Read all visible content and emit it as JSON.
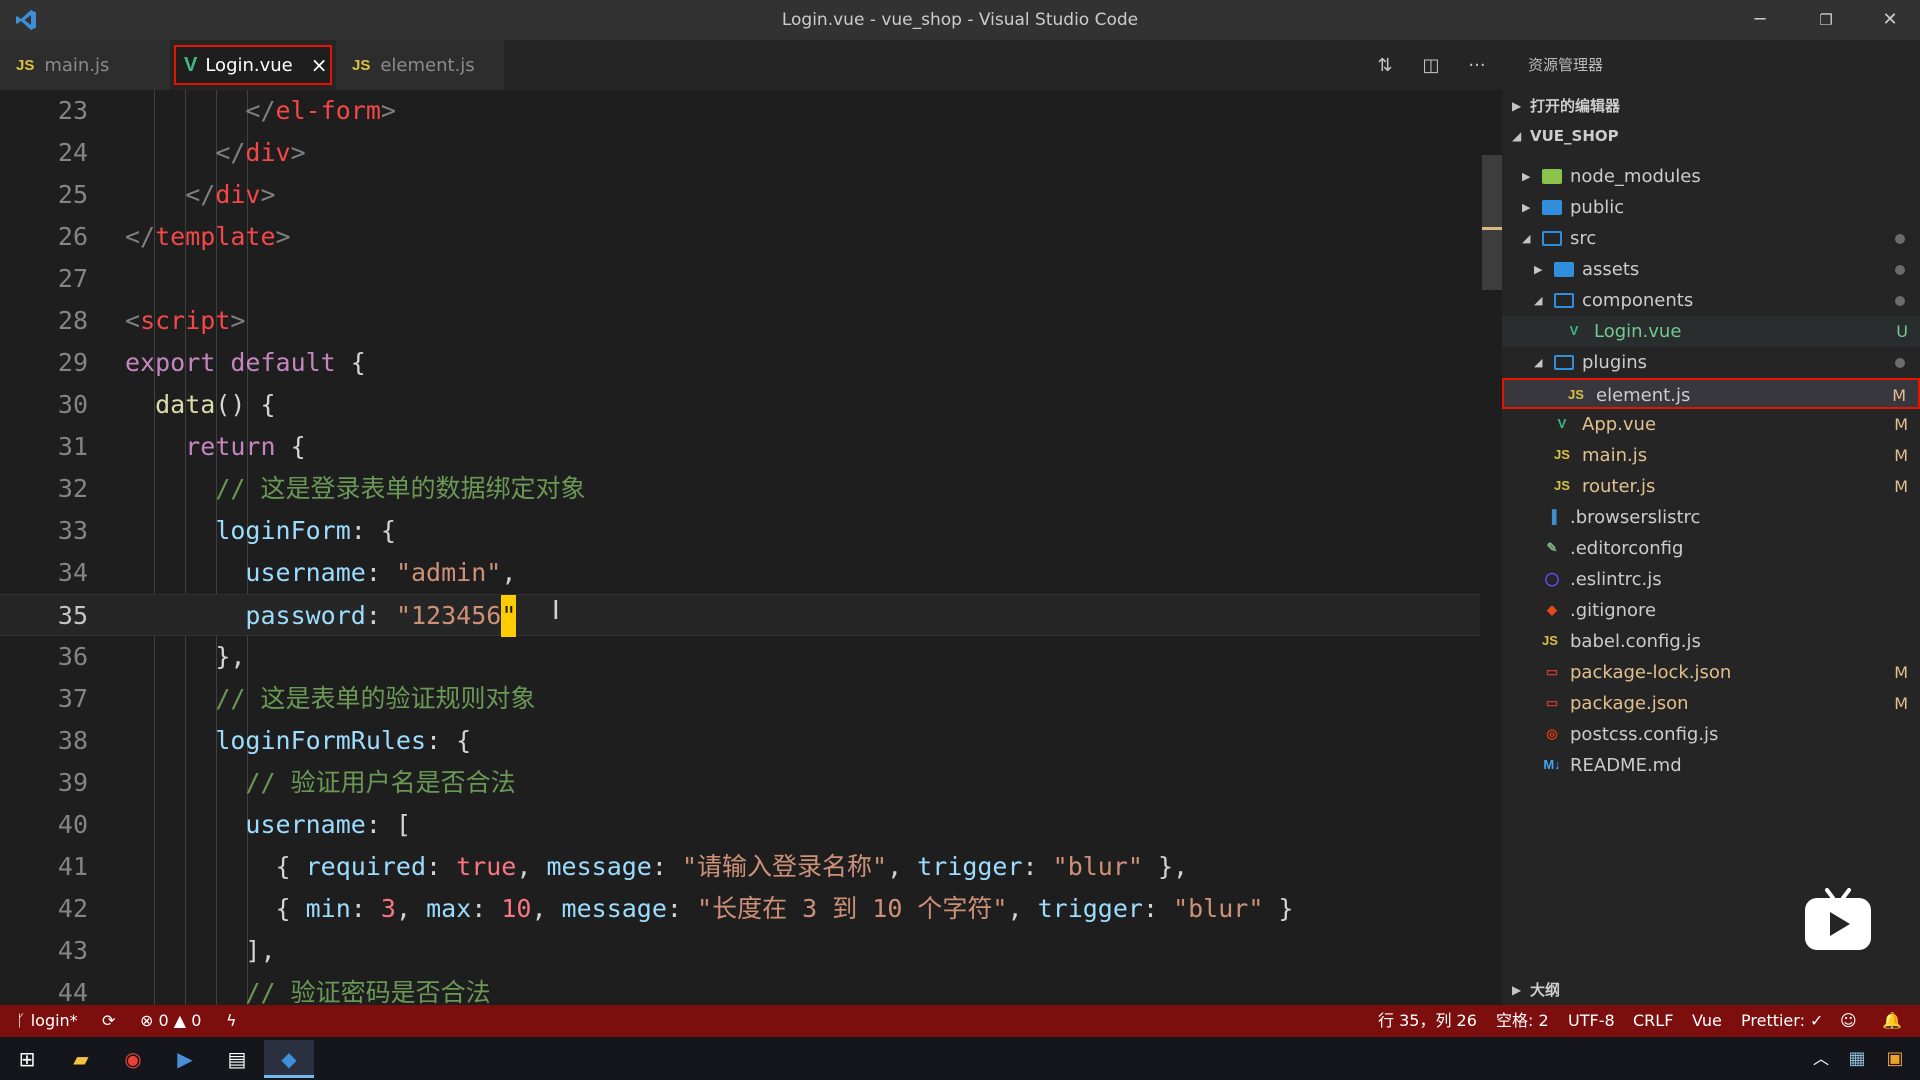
{
  "window": {
    "title": "Login.vue - vue_shop - Visual Studio Code"
  },
  "tabs": [
    {
      "icon": "JS",
      "label": "main.js"
    },
    {
      "icon": "V",
      "label": "Login.vue",
      "close": "×"
    },
    {
      "icon": "JS",
      "label": "element.js"
    }
  ],
  "editor": {
    "lines": [
      {
        "n": "23",
        "html": "        <span class='tagp'>&lt;/</span><span class='tag'>el-form</span><span class='tagp'>&gt;</span>"
      },
      {
        "n": "24",
        "html": "      <span class='tagp'>&lt;/</span><span class='tag'>div</span><span class='tagp'>&gt;</span>"
      },
      {
        "n": "25",
        "html": "    <span class='tagp'>&lt;/</span><span class='tag'>div</span><span class='tagp'>&gt;</span>"
      },
      {
        "n": "26",
        "html": "<span class='tagp'>&lt;/</span><span class='tag'>template</span><span class='tagp'>&gt;</span>"
      },
      {
        "n": "27",
        "html": ""
      },
      {
        "n": "28",
        "html": "<span class='tagp'>&lt;</span><span class='tag'>script</span><span class='tagp'>&gt;</span>"
      },
      {
        "n": "29",
        "html": "<span class='kw2'>export</span> <span class='kw2'>default</span> <span class='pun'>{</span>"
      },
      {
        "n": "30",
        "html": "  <span class='fn'>data</span><span class='pun'>() {</span>"
      },
      {
        "n": "31",
        "html": "    <span class='kw2'>return</span> <span class='pun'>{</span>"
      },
      {
        "n": "32",
        "html": "      <span class='cm'>// 这是登录表单的数据绑定对象</span>"
      },
      {
        "n": "33",
        "html": "      <span class='prop'>loginForm</span><span class='pun'>: {</span>"
      },
      {
        "n": "34",
        "html": "        <span class='prop'>username</span><span class='pun'>: </span><span class='str'>\"admin\"</span><span class='pun'>,</span>"
      },
      {
        "n": "35",
        "html": "        <span class='prop'>password</span><span class='pun'>: </span><span class='str'>\"123456<span class='cursor'>\"</span></span>"
      },
      {
        "n": "36",
        "html": "      <span class='pun'>},</span>"
      },
      {
        "n": "37",
        "html": "      <span class='cm'>// 这是表单的验证规则对象</span>"
      },
      {
        "n": "38",
        "html": "      <span class='prop'>loginFormRules</span><span class='pun'>: {</span>"
      },
      {
        "n": "39",
        "html": "        <span class='cm'>// 验证用户名是否合法</span>"
      },
      {
        "n": "40",
        "html": "        <span class='prop'>username</span><span class='pun'>: [</span>"
      },
      {
        "n": "41",
        "html": "          <span class='pun'>{ </span><span class='prop'>required</span><span class='pun'>: </span><span class='lit'>true</span><span class='pun'>, </span><span class='prop'>message</span><span class='pun'>: </span><span class='str'>\"请输入登录名称\"</span><span class='pun'>, </span><span class='prop'>trigger</span><span class='pun'>: </span><span class='str'>\"blur\"</span><span class='pun'> },</span>"
      },
      {
        "n": "42",
        "html": "          <span class='pun'>{ </span><span class='prop'>min</span><span class='pun'>: </span><span class='lit'>3</span><span class='pun'>, </span><span class='prop'>max</span><span class='pun'>: </span><span class='lit'>10</span><span class='pun'>, </span><span class='prop'>message</span><span class='pun'>: </span><span class='str'>\"长度在 3 到 10 个字符\"</span><span class='pun'>, </span><span class='prop'>trigger</span><span class='pun'>: </span><span class='str'>\"blur\"</span><span class='pun'> }</span>"
      },
      {
        "n": "43",
        "html": "        <span class='pun'>],</span>"
      },
      {
        "n": "44",
        "html": "        <span class='cm'>// 验证密码是否合法</span>"
      }
    ],
    "current_line": "35"
  },
  "explorer": {
    "header": "资源管理器",
    "open_editors": "打开的编辑器",
    "project": "VUE_SHOP",
    "outline": "大纲",
    "items": [
      {
        "name": "node_modules",
        "type": "folder",
        "depth": 0,
        "arrow": "▶",
        "icon_color": "#8bc34a",
        "status": ""
      },
      {
        "name": "public",
        "type": "folder",
        "depth": 0,
        "arrow": "▶",
        "icon_color": "#2f8fdd",
        "status": ""
      },
      {
        "name": "src",
        "type": "folder-open",
        "depth": 0,
        "arrow": "◢",
        "icon_color": "#2f8fdd",
        "status": "dot"
      },
      {
        "name": "assets",
        "type": "folder",
        "depth": 1,
        "arrow": "▶",
        "icon_color": "#2f8fdd",
        "status": "dot"
      },
      {
        "name": "components",
        "type": "folder-open",
        "depth": 1,
        "arrow": "◢",
        "icon_color": "#2f8fdd",
        "status": "dot"
      },
      {
        "name": "Login.vue",
        "type": "vue",
        "depth": 2,
        "arrow": "",
        "icon_color": "#41b883",
        "status": "U",
        "name_color": "#73c991"
      },
      {
        "name": "plugins",
        "type": "folder-open",
        "depth": 1,
        "arrow": "◢",
        "icon_color": "#2f8fdd",
        "status": "dot"
      },
      {
        "name": "element.js",
        "type": "js",
        "depth": 2,
        "arrow": "",
        "icon_color": "#d8c242",
        "status": "M",
        "selected": true
      },
      {
        "name": "App.vue",
        "type": "vue",
        "depth": 1,
        "arrow": "",
        "icon_color": "#41b883",
        "status": "M",
        "name_color": "#e2c08d"
      },
      {
        "name": "main.js",
        "type": "js",
        "depth": 1,
        "arrow": "",
        "icon_color": "#d8c242",
        "status": "M",
        "name_color": "#e2c08d"
      },
      {
        "name": "router.js",
        "type": "js",
        "depth": 1,
        "arrow": "",
        "icon_color": "#d8c242",
        "status": "M",
        "name_color": "#e2c08d"
      },
      {
        "name": ".browserslistrc",
        "type": "file",
        "depth": 0,
        "arrow": "",
        "icon_color": "#3d8fd1",
        "status": ""
      },
      {
        "name": ".editorconfig",
        "type": "gear",
        "depth": 0,
        "arrow": "",
        "icon_color": "#7fb28a",
        "status": ""
      },
      {
        "name": ".eslintrc.js",
        "type": "eslint",
        "depth": 0,
        "arrow": "",
        "icon_color": "#6c4fff",
        "status": ""
      },
      {
        "name": ".gitignore",
        "type": "git",
        "depth": 0,
        "arrow": "",
        "icon_color": "#e64a19",
        "status": ""
      },
      {
        "name": "babel.config.js",
        "type": "js",
        "depth": 0,
        "arrow": "",
        "icon_color": "#d8c242",
        "status": ""
      },
      {
        "name": "package-lock.json",
        "type": "npm",
        "depth": 0,
        "arrow": "",
        "icon_color": "#cb3837",
        "status": "M",
        "name_color": "#e2c08d"
      },
      {
        "name": "package.json",
        "type": "npm",
        "depth": 0,
        "arrow": "",
        "icon_color": "#cb3837",
        "status": "M",
        "name_color": "#e2c08d"
      },
      {
        "name": "postcss.config.js",
        "type": "postcss",
        "depth": 0,
        "arrow": "",
        "icon_color": "#dd3a0a",
        "status": ""
      },
      {
        "name": "README.md",
        "type": "md",
        "depth": 0,
        "arrow": "",
        "icon_color": "#42a5f5",
        "status": ""
      }
    ]
  },
  "statusbar": {
    "branch": "login*",
    "errors": "0",
    "warnings": "0",
    "position": "行 35，列 26",
    "spaces": "空格: 2",
    "encoding": "UTF-8",
    "eol": "CRLF",
    "language": "Vue",
    "formatter": "Prettier: ✓"
  },
  "colors": {
    "status_bg": "#7d0e0e",
    "highlight_border": "#e51400"
  }
}
